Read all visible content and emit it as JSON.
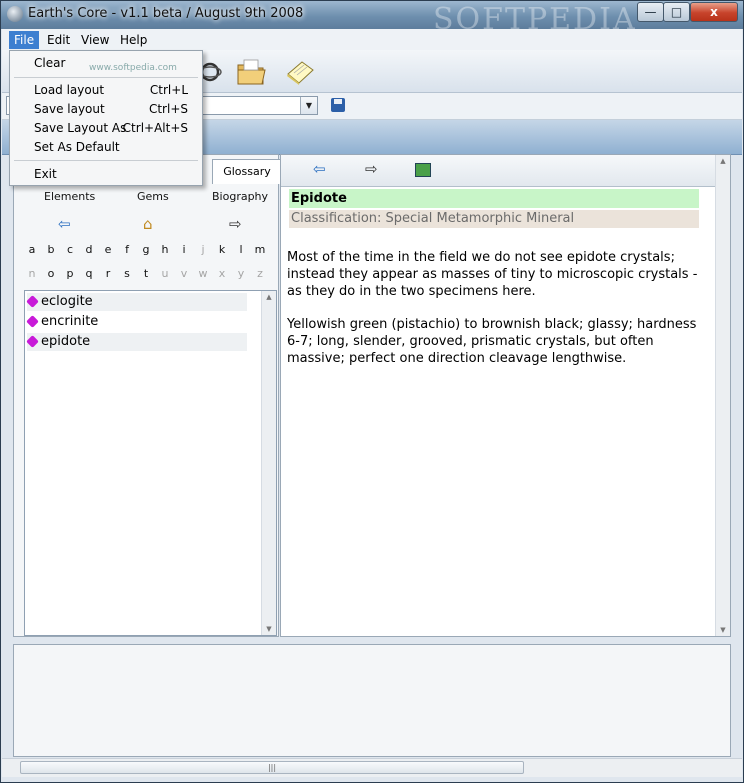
{
  "window": {
    "title": "Earth's Core - v1.1 beta / August 9th 2008",
    "watermark": "SOFTPEDIA",
    "minimize": "—",
    "maximize": "□",
    "close": "x"
  },
  "menubar": {
    "items": [
      {
        "label": "File"
      },
      {
        "label": "Edit"
      },
      {
        "label": "View"
      },
      {
        "label": "Help"
      }
    ]
  },
  "file_menu": {
    "items": [
      {
        "label": "Clear",
        "shortcut": ""
      },
      {
        "label": "Load layout",
        "shortcut": "Ctrl+L"
      },
      {
        "label": "Save layout",
        "shortcut": "Ctrl+S"
      },
      {
        "label": "Save Layout As",
        "shortcut": "Ctrl+Alt+S"
      },
      {
        "label": "Set As Default",
        "shortcut": ""
      },
      {
        "label": "Exit",
        "shortcut": ""
      }
    ]
  },
  "toolbar": {
    "icons": [
      "magnifier-icon",
      "folder-icon",
      "notepad-icon",
      "save-icon"
    ],
    "softpedia_text": "www.softpedia.com"
  },
  "left_pane": {
    "tab": "Glossary",
    "categories": [
      "Elements",
      "Gems",
      "Biography"
    ],
    "letters_row1": [
      "a",
      "b",
      "c",
      "d",
      "e",
      "f",
      "g",
      "h",
      "i",
      "j",
      "k",
      "l",
      "m"
    ],
    "letters_row2": [
      "n",
      "o",
      "p",
      "q",
      "r",
      "s",
      "t",
      "u",
      "v",
      "w",
      "x",
      "y",
      "z"
    ],
    "disabled_letters": [
      "j",
      "n",
      "u",
      "v",
      "w",
      "x",
      "y",
      "z"
    ],
    "list": [
      {
        "label": "eclogite"
      },
      {
        "label": "encrinite"
      },
      {
        "label": "epidote"
      }
    ]
  },
  "right_pane": {
    "heading": "Epidote",
    "classification": "Classification: Special Metamorphic Mineral",
    "paragraph1": "Most of the time in the field we do not see epidote crystals; instead they appear as masses of tiny to microscopic crystals - as they do in the two specimens here.",
    "paragraph2": "Yellowish green (pistachio) to brownish black; glassy; hardness 6-7; long, slender, grooved, prismatic crystals, but often massive; perfect one direction cleavage lengthwise."
  },
  "scrollbars": {
    "up": "▲",
    "down": "▼",
    "grip": "|||"
  },
  "colors": {
    "accent": "#3d7fd0",
    "heading_bg": "#c8f5c8",
    "classification_bg": "#ebe3da",
    "gem_icon": "#c81ad8"
  }
}
